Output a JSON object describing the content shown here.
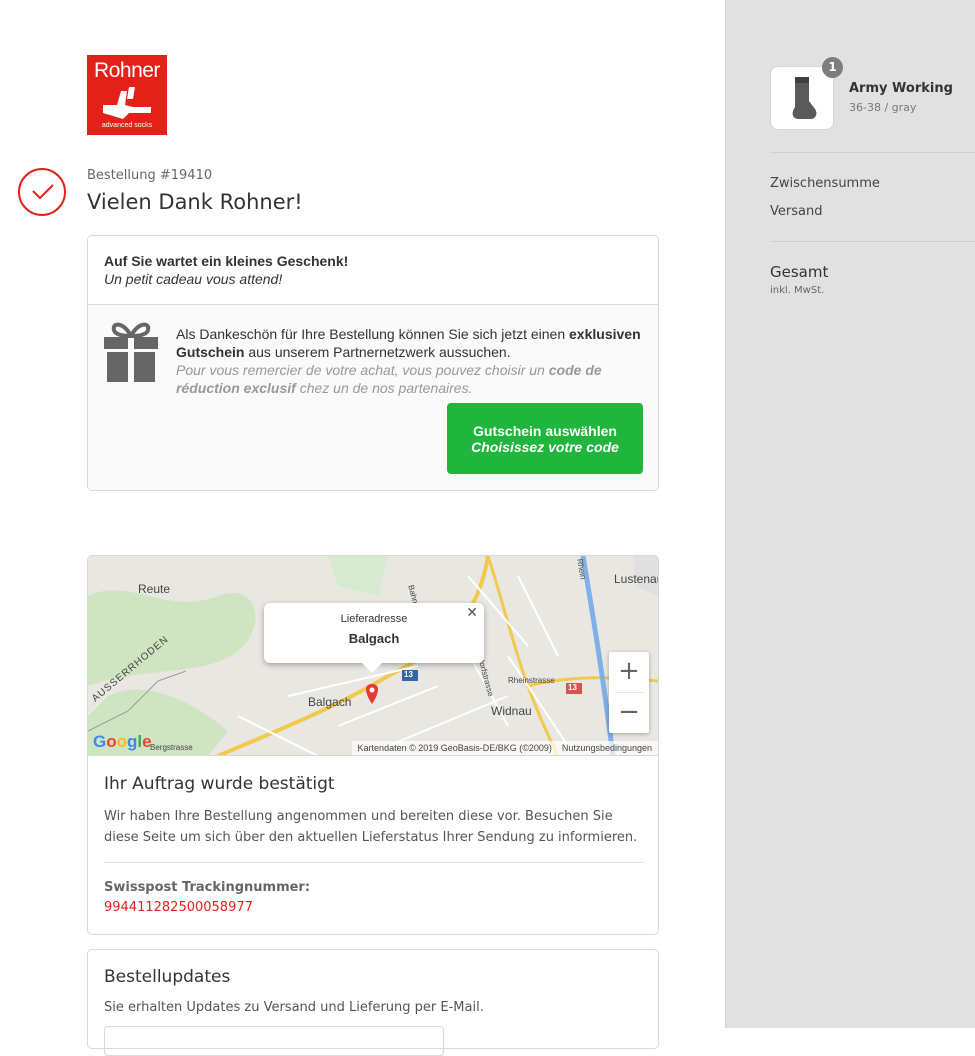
{
  "brand": {
    "name": "Rohner",
    "tagline": "advanced socks",
    "colors": {
      "primary": "#e32119",
      "button": "#20b63d",
      "link": "#e32119"
    }
  },
  "order": {
    "number_label": "Bestellung #19410",
    "thanks": "Vielen Dank Rohner!"
  },
  "gift": {
    "title": "Auf Sie wartet ein kleines Geschenk!",
    "title_fr": "Un petit cadeau vous attend!",
    "text_1": "Als Dankeschön für Ihre Bestellung können Sie sich jetzt einen",
    "text_bold_1": "exklusiven Gutschein",
    "text_2": "aus unserem Partnernetzwerk aussuchen.",
    "text_fr_1": "Pour vous remercier de votre achat, vous pouvez choisir un",
    "text_fr_bold": "code de réduction exclusif",
    "text_fr_2": "chez un de nos partenaires.",
    "button_label": "Gutschein auswählen",
    "button_label_fr": "Choisissez votre code",
    "icon": "gift-icon"
  },
  "map": {
    "popup_label": "Lieferadresse",
    "popup_city": "Balgach",
    "close_icon": "close-icon",
    "zoom_in": "+",
    "zoom_out": "−",
    "places": [
      "Reute",
      "Lustenau",
      "Balgach",
      "Widnau",
      "AUSSERRHODEN",
      "Rheinstrasse",
      "Unterdorfstrasse",
      "Bergstrasse",
      "Bahnhofstrasse",
      "Rhein"
    ],
    "road_badges": [
      "13",
      "13"
    ],
    "attribution": "Kartendaten © 2019 GeoBasis-DE/BKG (©2009)",
    "terms": "Nutzungsbedingungen",
    "google": "Google"
  },
  "confirmation": {
    "title": "Ihr Auftrag wurde bestätigt",
    "text": "Wir haben Ihre Bestellung angenommen und bereiten diese vor. Besuchen Sie diese Seite um sich über den aktuellen Lieferstatus Ihrer Sendung zu informieren.",
    "tracking_label": "Swisspost Trackingnummer:",
    "tracking_number": "994411282500058977"
  },
  "updates": {
    "title": "Bestellupdates",
    "text": "Sie erhalten Updates zu Versand und Lieferung per E-Mail."
  },
  "summary": {
    "item": {
      "quantity": "1",
      "name": "Army Working",
      "variant": "36-38 / gray"
    },
    "subtotal_label": "Zwischensumme",
    "shipping_label": "Versand",
    "total_label": "Gesamt",
    "total_sub": "inkl. MwSt."
  }
}
